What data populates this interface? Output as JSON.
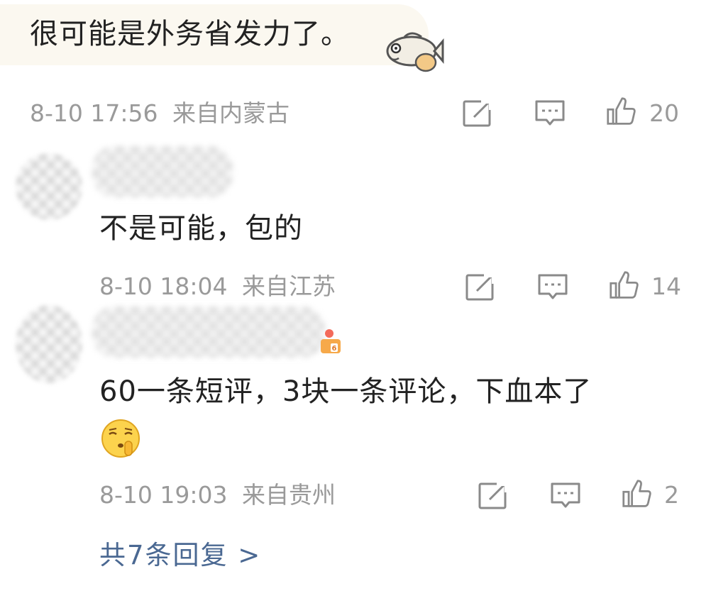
{
  "comment": {
    "text": "很可能是外务省发力了。",
    "sticker_icon": "fish-icon",
    "date": "8-10 17:56",
    "location": "来自内蒙古",
    "likes": "20"
  },
  "replies": [
    {
      "text": "不是可能，包的",
      "date": "8-10 18:04",
      "location": "来自江苏",
      "likes": "14"
    },
    {
      "text": "60一条短评，3块一条评论，下血本了",
      "emoji_icon": "shush-face-icon",
      "date": "8-10 19:03",
      "location": "来自贵州",
      "likes": "2"
    }
  ],
  "more_replies": "共7条回复 >",
  "colors": {
    "meta": "#9a9a9a",
    "link": "#4a6892",
    "bubble": "#fbf8f0"
  }
}
